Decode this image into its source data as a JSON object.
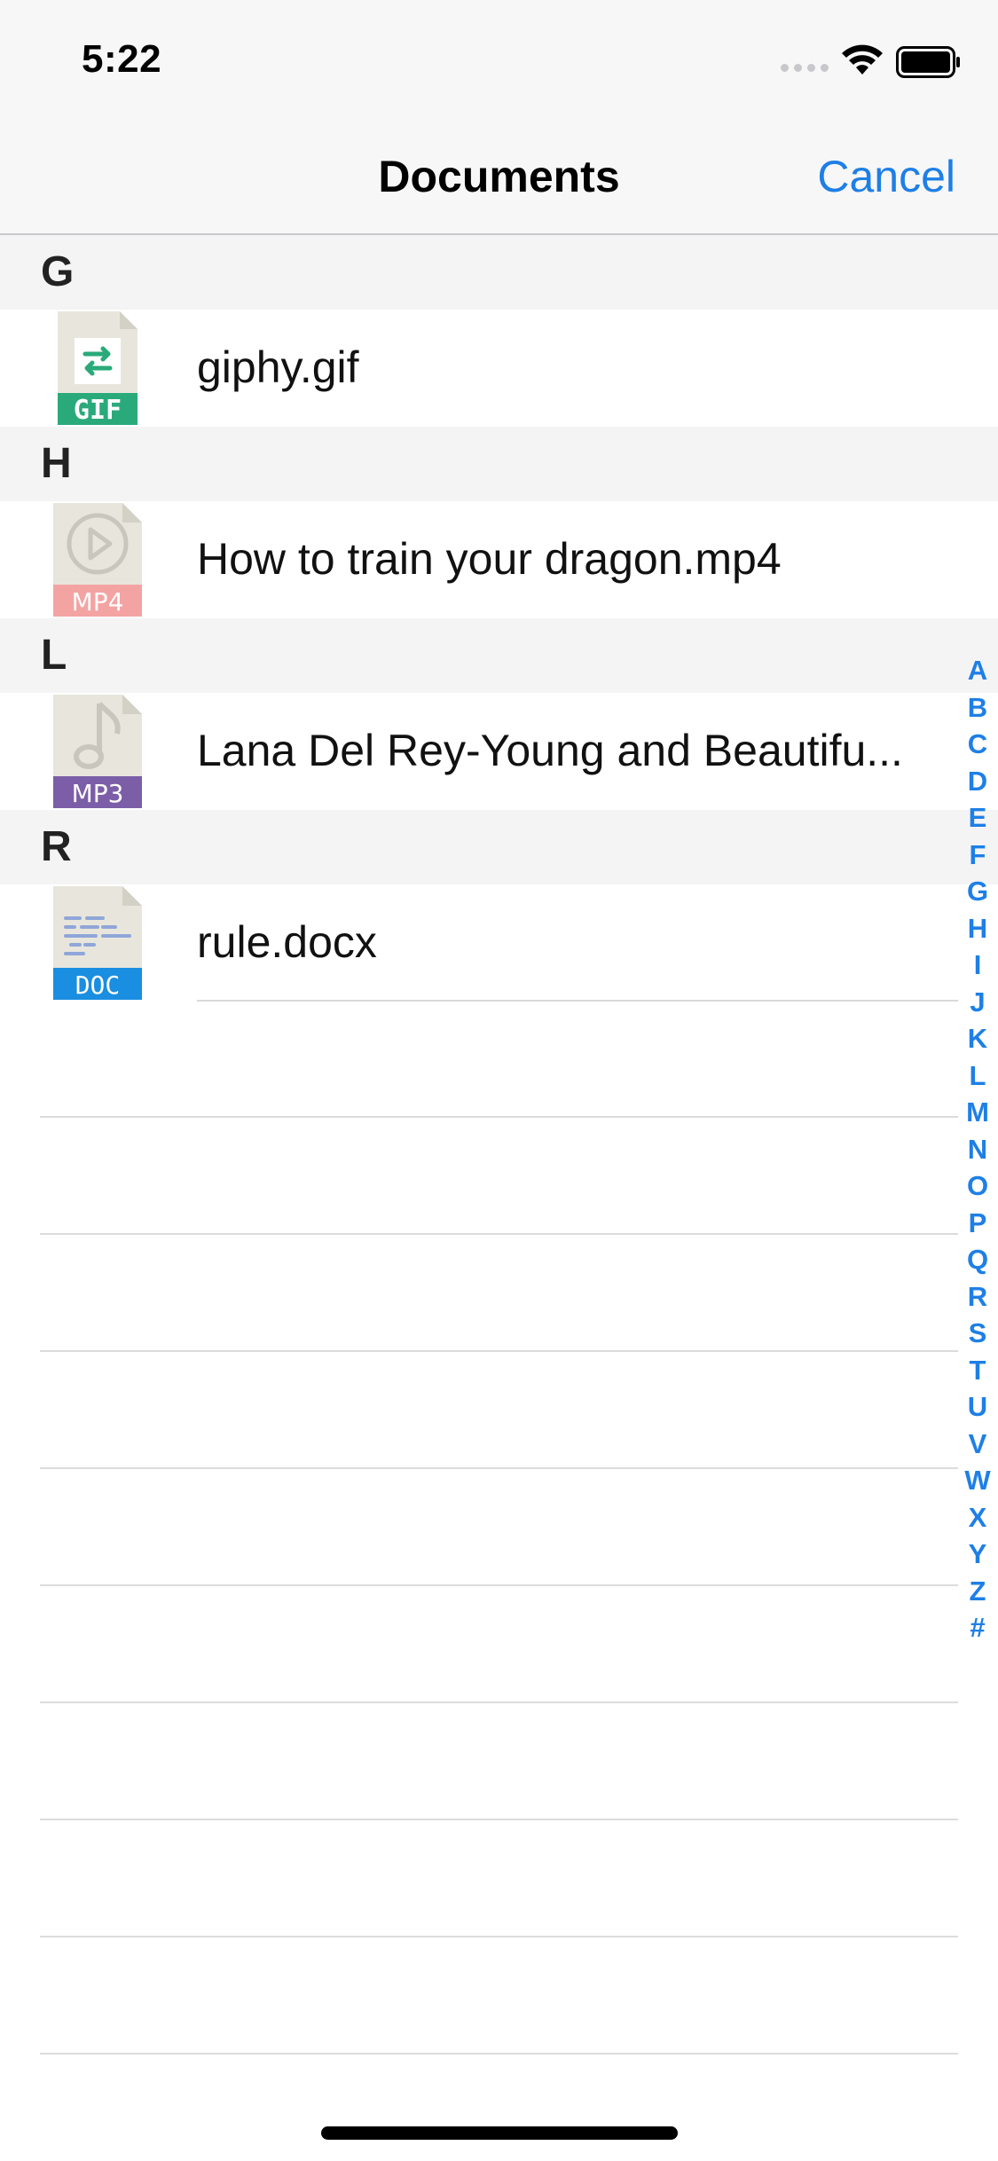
{
  "status_bar": {
    "time": "5:22"
  },
  "nav": {
    "title": "Documents",
    "cancel_label": "Cancel"
  },
  "sections": [
    {
      "letter": "G",
      "file": {
        "name": "giphy.gif",
        "badge": "GIF",
        "icon": "gif-file-icon",
        "badge_color": "#2aaa7a"
      }
    },
    {
      "letter": "H",
      "file": {
        "name": "How to train your dragon.mp4",
        "badge": "MP4",
        "icon": "mp4-file-icon",
        "badge_color": "#f4a3a3"
      }
    },
    {
      "letter": "L",
      "file": {
        "name": "Lana Del Rey-Young and Beautifu...",
        "badge": "MP3",
        "icon": "mp3-file-icon",
        "badge_color": "#7b5ea7"
      }
    },
    {
      "letter": "R",
      "file": {
        "name": "rule.docx",
        "badge": "DOC",
        "icon": "doc-file-icon",
        "badge_color": "#1a8ee0"
      }
    }
  ],
  "index_letters": [
    "A",
    "B",
    "C",
    "D",
    "E",
    "F",
    "G",
    "H",
    "I",
    "J",
    "K",
    "L",
    "M",
    "N",
    "O",
    "P",
    "Q",
    "R",
    "S",
    "T",
    "U",
    "V",
    "W",
    "X",
    "Y",
    "Z",
    "#"
  ],
  "colors": {
    "accent": "#1e7fe6",
    "header_bg": "#f4f4f4",
    "nav_bg": "#f7f7f7"
  }
}
